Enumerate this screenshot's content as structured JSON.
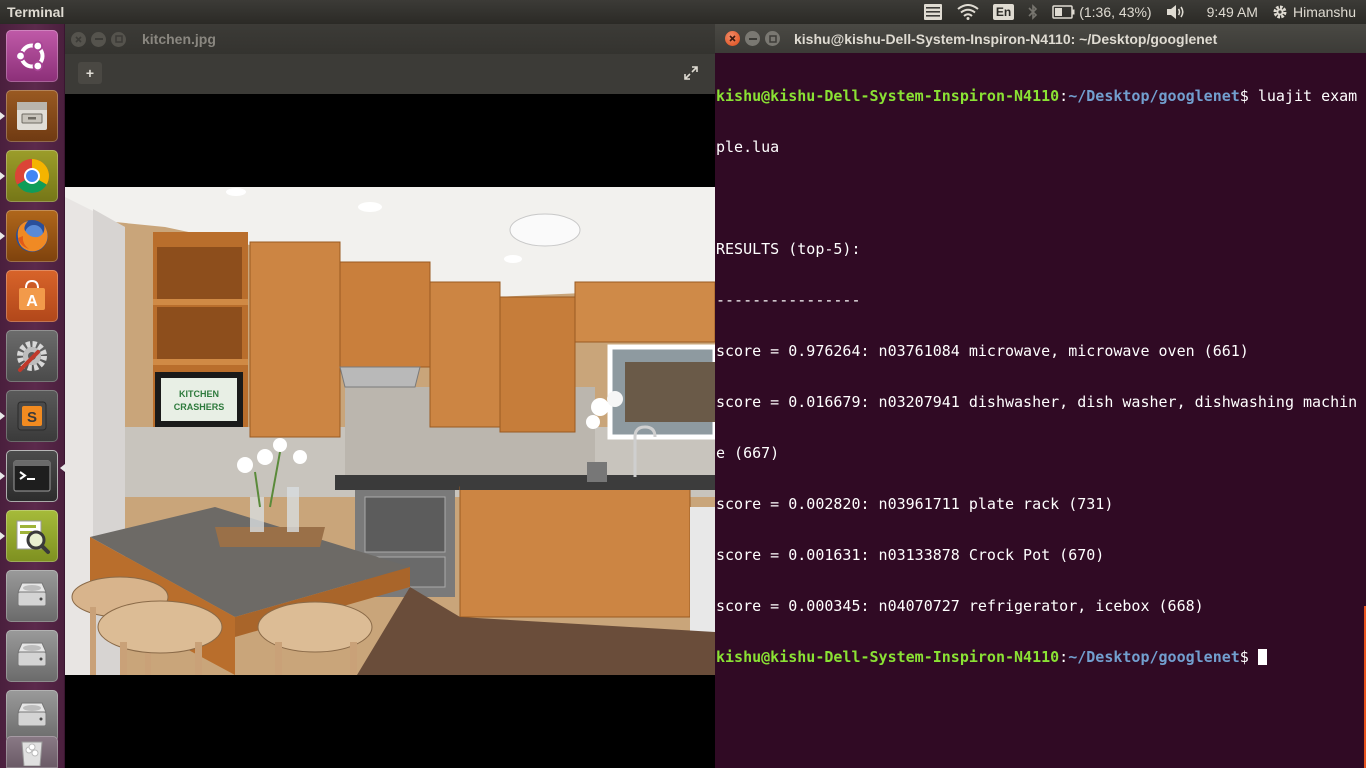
{
  "panel": {
    "app_title": "Terminal",
    "keyboard_layout": "En",
    "battery_text": "(1:36, 43%)",
    "clock": "9:49 AM",
    "user_name": "Himanshu"
  },
  "launcher": {
    "items": [
      {
        "name": "ubuntu-dash-icon"
      },
      {
        "name": "files-icon"
      },
      {
        "name": "chrome-icon"
      },
      {
        "name": "firefox-icon"
      },
      {
        "name": "software-center-icon"
      },
      {
        "name": "system-settings-icon"
      },
      {
        "name": "sublime-text-icon"
      },
      {
        "name": "terminal-icon"
      },
      {
        "name": "image-viewer-icon"
      },
      {
        "name": "drive-icon"
      },
      {
        "name": "drive-icon"
      },
      {
        "name": "drive-icon"
      },
      {
        "name": "trash-icon"
      }
    ]
  },
  "viewer": {
    "title": "kitchen.jpg",
    "add_label": "+",
    "image_text": [
      "KITCHEN",
      "CRASHERS"
    ]
  },
  "terminal": {
    "title": "kishu@kishu-Dell-System-Inspiron-N4110: ~/Desktop/googlenet",
    "prompt_user": "kishu@kishu-Dell-System-Inspiron-N4110",
    "prompt_sep": ":",
    "prompt_path": "~/Desktop/googlenet",
    "prompt_end": "$ ",
    "command_part1": "luajit exam",
    "command_part2": "ple.lua",
    "output": [
      "",
      "RESULTS (top-5):",
      "----------------",
      "score = 0.976264: n03761084 microwave, microwave oven (661)",
      "score = 0.016679: n03207941 dishwasher, dish washer, dishwashing machin",
      "e (667)",
      "score = 0.002820: n03961711 plate rack (731)",
      "score = 0.001631: n03133878 Crock Pot (670)",
      "score = 0.000345: n04070727 refrigerator, icebox (668)"
    ]
  },
  "colors": {
    "terminal_bg": "#300a24",
    "prompt_user": "#8ae234",
    "prompt_path": "#729fcf",
    "launcher_bg": "#5c2a4c",
    "panel_bg": "#3c3b37",
    "close_button": "#df4a16"
  }
}
